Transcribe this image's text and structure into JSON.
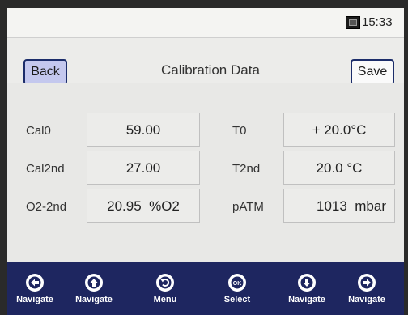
{
  "status": {
    "time": "15:33"
  },
  "header": {
    "back_label": "Back",
    "title": "Calibration Data",
    "save_label": "Save"
  },
  "fields": {
    "cal0": {
      "label": "Cal0",
      "value": "59.00"
    },
    "cal2nd": {
      "label": "Cal2nd",
      "value": "27.00"
    },
    "o2_2nd": {
      "label": "O2-2nd",
      "value": "20.95  %O2"
    },
    "t0": {
      "label": "T0",
      "value": "+ 20.0°C"
    },
    "t2nd": {
      "label": "T2nd",
      "value": "20.0 °C"
    },
    "patm": {
      "label": "pATM",
      "value": "1013  mbar"
    }
  },
  "nav": [
    {
      "label": "Navigate",
      "icon": "arrow-left-icon"
    },
    {
      "label": "Navigate",
      "icon": "arrow-up-icon"
    },
    {
      "label": "Menu",
      "icon": "menu-back-icon"
    },
    {
      "label": "Select",
      "icon": "ok-icon"
    },
    {
      "label": "Navigate",
      "icon": "arrow-down-icon"
    },
    {
      "label": "Navigate",
      "icon": "arrow-right-icon"
    }
  ],
  "colors": {
    "navbar": "#1e2660",
    "back_button": "#c4c8ee",
    "border": "#1c2d6a"
  }
}
